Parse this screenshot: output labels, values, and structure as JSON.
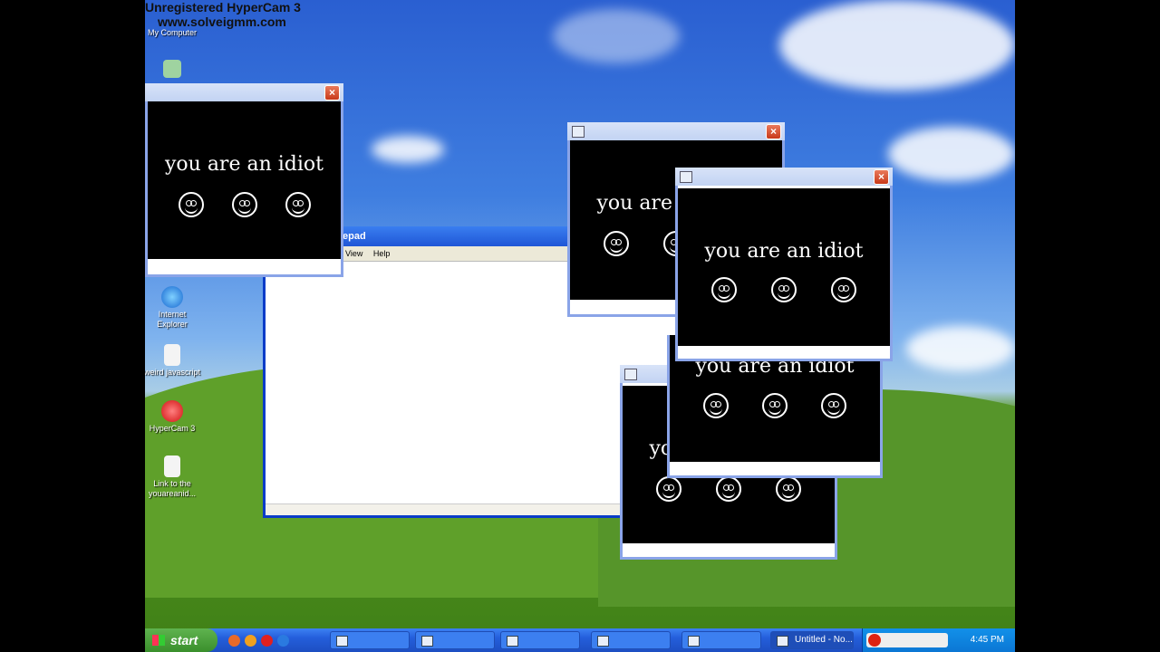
{
  "watermark": {
    "line1": "Unregistered HyperCam 3",
    "line2": "www.solveigmm.com"
  },
  "desktop_icons": [
    {
      "label": "My Computer"
    },
    {
      "label": "Internet Explorer"
    },
    {
      "label": "weird javascript"
    },
    {
      "label": "HyperCam 3"
    },
    {
      "label": "Link to the youareanid..."
    }
  ],
  "popup_text": "you are an idiot",
  "close_glyph": "×",
  "notepad": {
    "title_fragment": "epad",
    "menu": [
      "View",
      "Help"
    ]
  },
  "taskbar": {
    "start_label": "start",
    "notepad_button": "Untitled - No...",
    "clock": "4:45 PM"
  }
}
